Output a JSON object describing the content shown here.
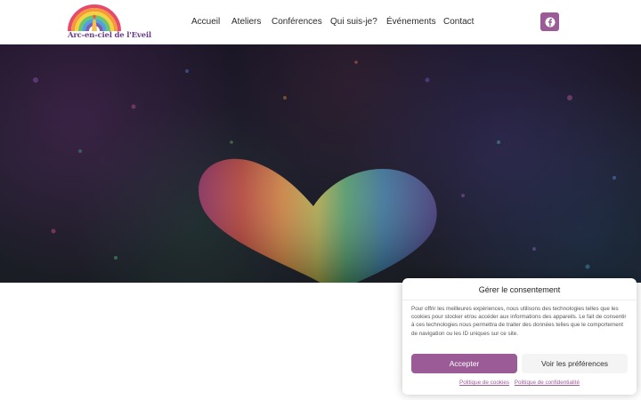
{
  "site": {
    "logo_text": "Arc-en-ciel de l'Eveil",
    "logo_icon": "rainbow-logo-icon"
  },
  "nav": {
    "items": [
      {
        "label": "Accueil"
      },
      {
        "label": "Ateliers"
      },
      {
        "label": "Conférences"
      },
      {
        "label": "Qui suis-je?"
      },
      {
        "label": "Événements"
      },
      {
        "label": "Contact"
      }
    ]
  },
  "social": {
    "facebook_icon": "facebook-icon",
    "color": "#9b5b96"
  },
  "hero": {
    "image": "rainbow-chalk-heart-on-dark-ground"
  },
  "consent": {
    "title": "Gérer le consentement",
    "body": "Pour offrir les meilleures expériences, nous utilisons des technologies telles que les cookies pour stocker et/ou accéder aux informations des appareils. Le fait de consentir à ces technologies nous permettra de traiter des données telles que le comportement de navigation ou les ID uniques sur ce site.",
    "accept_label": "Accepter",
    "prefs_label": "Voir les préférences",
    "cookie_policy_link": "Politique de cookies",
    "privacy_policy_link": "Politique de confidentialité",
    "accent_color": "#9b5b96"
  }
}
